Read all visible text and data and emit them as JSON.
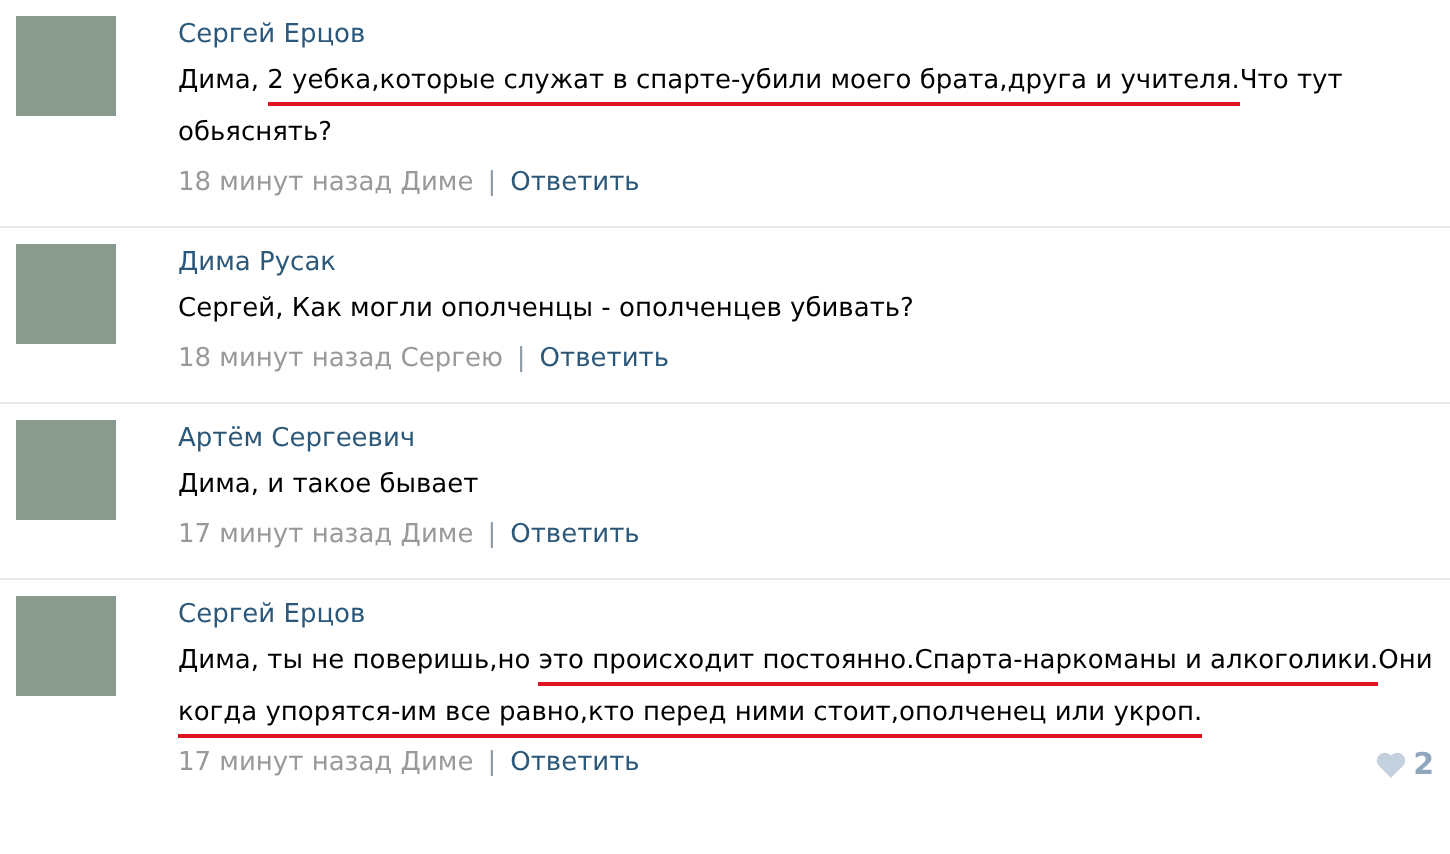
{
  "comments": [
    {
      "author": "Сергей Ерцов",
      "segments": [
        {
          "text": "Дима, ",
          "underlined": false
        },
        {
          "text": "2 уебка,которые служат в спарте-убили моего брата,друга и учителя.",
          "underlined": true
        },
        {
          "text": "Что тут обьяснять?",
          "underlined": false
        }
      ],
      "time": "18 минут назад Диме",
      "separator": "|",
      "reply": "Ответить"
    },
    {
      "author": "Дима Русак",
      "segments": [
        {
          "text": "Сергей, Как могли ополченцы - ополченцев убивать?",
          "underlined": false
        }
      ],
      "time": "18 минут назад Сергею",
      "separator": "|",
      "reply": "Ответить"
    },
    {
      "author": "Артём Сергеевич",
      "segments": [
        {
          "text": "Дима, и такое бывает",
          "underlined": false
        }
      ],
      "time": "17 минут назад Диме",
      "separator": "|",
      "reply": "Ответить"
    },
    {
      "author": "Сергей Ерцов",
      "segments": [
        {
          "text": "Дима, ты не поверишь,но ",
          "underlined": false
        },
        {
          "text": "это происходит постоянно.Спарта-наркоманы и алкоголики.",
          "underlined": true
        },
        {
          "text": "Они ",
          "underlined": false
        },
        {
          "text": "когда упорятся-им все равно,кто перед ними стоит,ополченец или укроп.",
          "underlined": true
        }
      ],
      "time": "17 минут назад Диме",
      "separator": "|",
      "reply": "Ответить",
      "likes": "2"
    }
  ]
}
